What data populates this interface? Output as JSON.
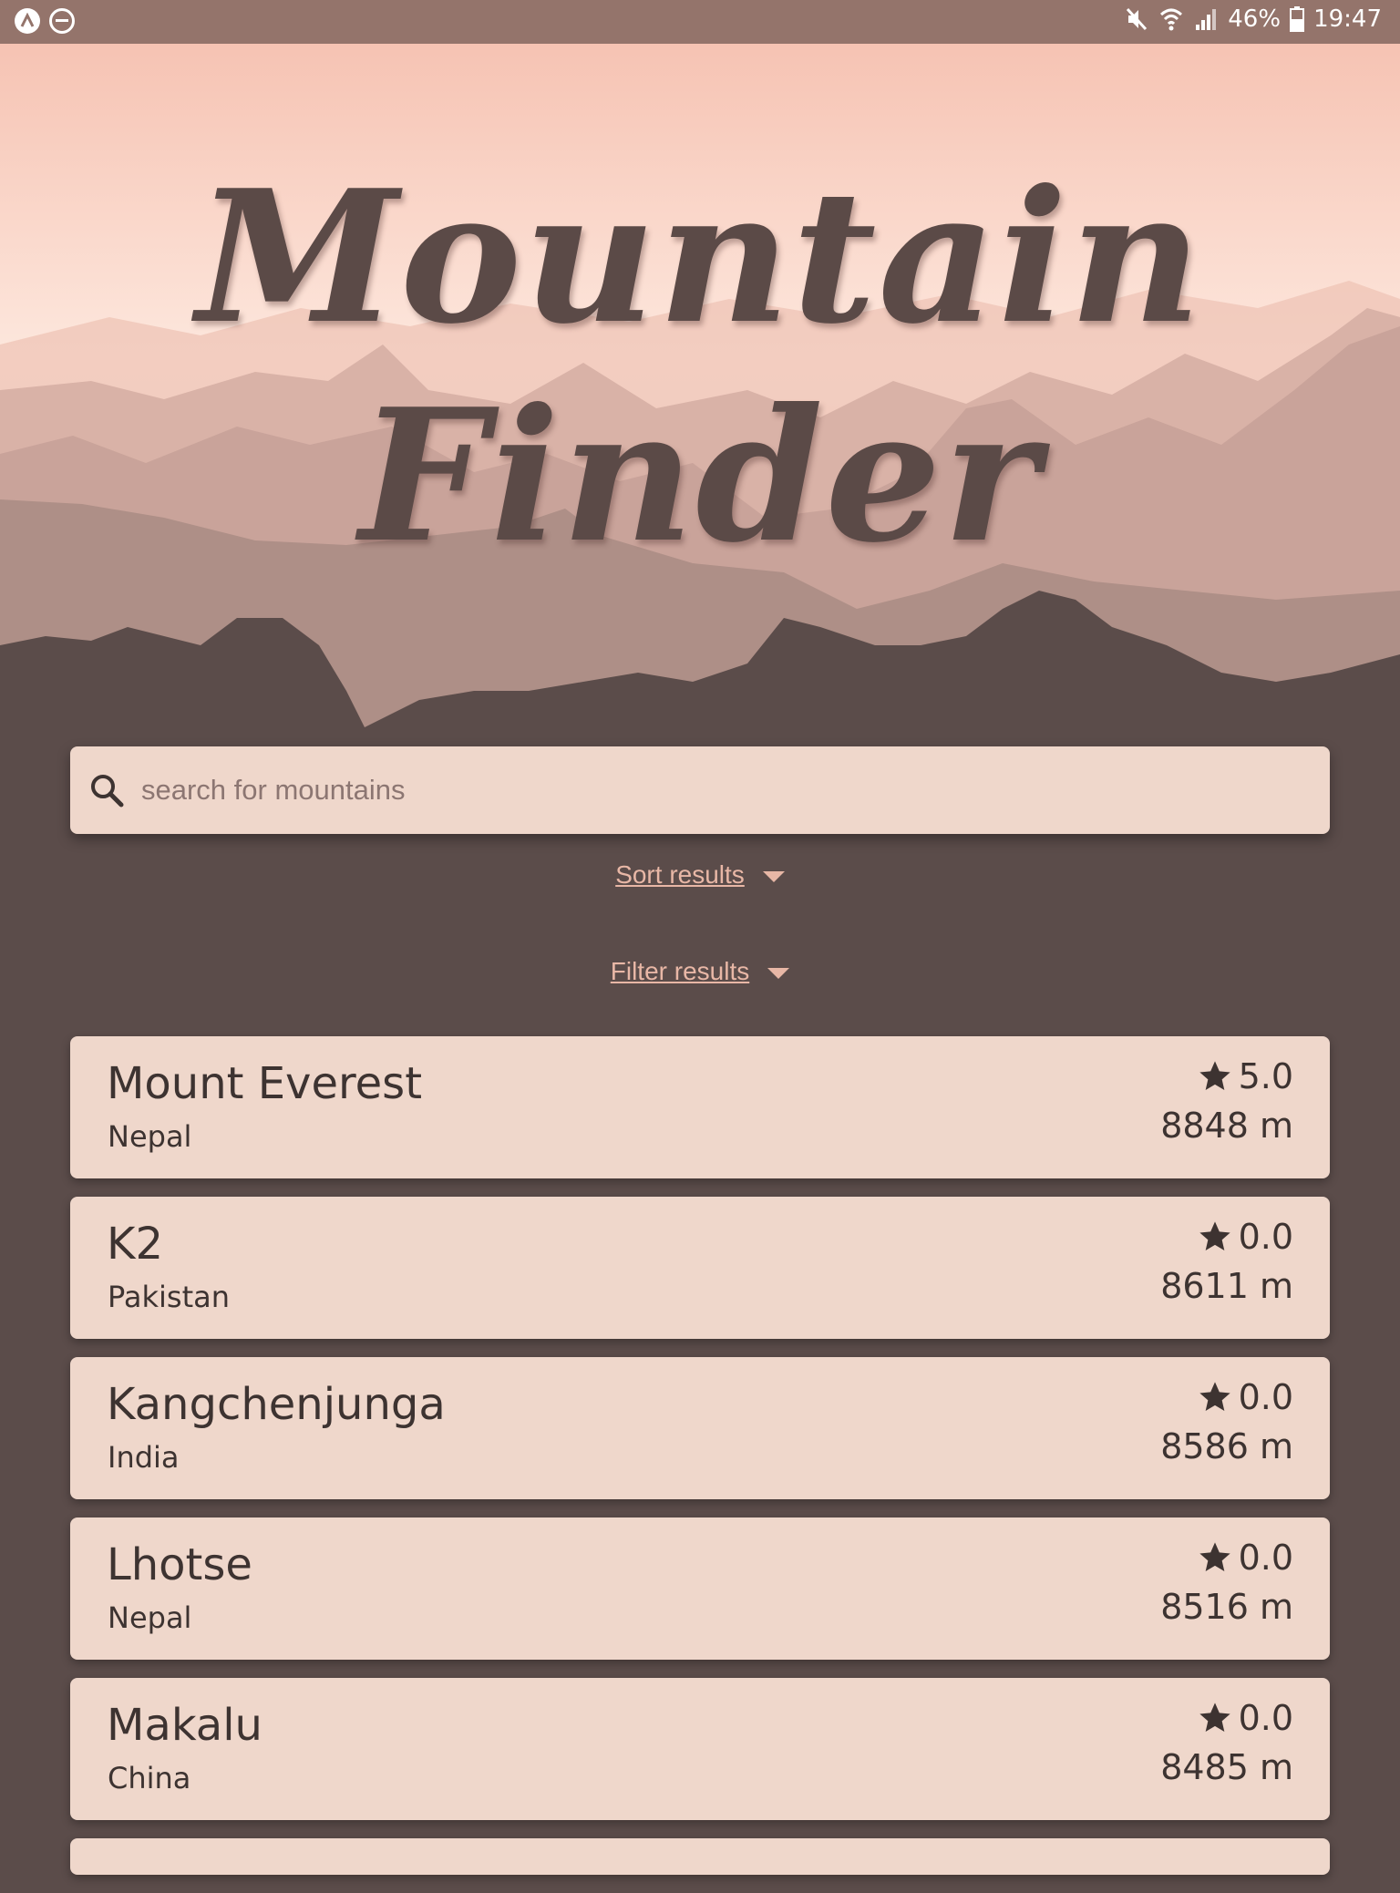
{
  "status_bar": {
    "battery": "46%",
    "time": "19:47",
    "icons": [
      "app-icon",
      "do-not-disturb-icon",
      "mute-icon",
      "wifi-icon",
      "signal-icon",
      "battery-icon"
    ]
  },
  "header": {
    "title": "Mountain Finder"
  },
  "search": {
    "placeholder": "search for mountains",
    "value": "",
    "icon": "search-icon"
  },
  "controls": {
    "sort_label": "Sort results",
    "filter_label": "Filter results"
  },
  "results": [
    {
      "name": "Mount Everest",
      "country": "Nepal",
      "rating": "5.0",
      "height": "8848 m"
    },
    {
      "name": "K2",
      "country": "Pakistan",
      "rating": "0.0",
      "height": "8611 m"
    },
    {
      "name": "Kangchenjunga",
      "country": "India",
      "rating": "0.0",
      "height": "8586 m"
    },
    {
      "name": "Lhotse",
      "country": "Nepal",
      "rating": "0.0",
      "height": "8516 m"
    },
    {
      "name": "Makalu",
      "country": "China",
      "rating": "0.0",
      "height": "8485 m"
    }
  ],
  "colors": {
    "background": "#5b4c4a",
    "card": "#efd7cb",
    "accent_link": "#e8b7a6",
    "status_bar": "#94746b",
    "text_dark": "#3d3331"
  }
}
